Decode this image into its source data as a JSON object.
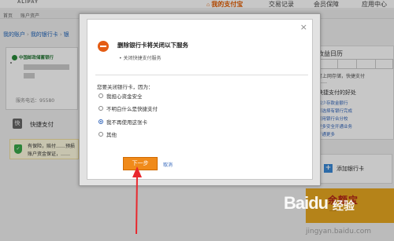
{
  "header": {
    "logo": "ALIPAY",
    "nav": [
      {
        "label": "我的支付宝",
        "active": true
      },
      {
        "label": "交易记录",
        "active": false
      },
      {
        "label": "会员保障",
        "active": false
      },
      {
        "label": "应用中心",
        "active": false
      }
    ]
  },
  "subnav": [
    "首页",
    "账户资产"
  ],
  "breadcrumb": [
    "我的账户",
    "我的银行卡",
    "银"
  ],
  "card": {
    "bank_name": "中国邮政储蓄银行",
    "phone": "服务电话：95580"
  },
  "quickpay": {
    "icon": "快",
    "label": "快捷支付"
  },
  "promo": {
    "line1": "有保险，赔付……预损",
    "line2": "账户资金保证，……"
  },
  "right_panel": {
    "title": "收益日历",
    "lines": [
      "可上网存储，快捷支付",
      "……"
    ],
    "section": "快捷支付的好处",
    "links": [
      "最少存款金额行",
      "可选择有银行完成",
      "可用银行合分校",
      "更多安全开通业务",
      "开通更多"
    ]
  },
  "add_card": {
    "label": "添加银行卡"
  },
  "yeb": {
    "label": "余额宝",
    "sub": "……"
  },
  "watermark": {
    "brand": "Baidu",
    "tag": "经验",
    "url": "jingyan.baidu.com"
  },
  "modal": {
    "close": "×",
    "title": "删除银行卡将关闭以下服务",
    "bullet": "• 关闭快捷支付服务",
    "reason_label": "您要关闭银行卡，因为：",
    "options": [
      {
        "label": "我担心资金安全",
        "checked": false
      },
      {
        "label": "不明白什么是快捷支付",
        "checked": false
      },
      {
        "label": "我不再使用这张卡",
        "checked": true
      },
      {
        "label": "其他",
        "checked": false
      }
    ],
    "next_button": "下一步",
    "cancel_link": "取消"
  },
  "colors": {
    "accent": "#e25c00",
    "button": "#f08a1a",
    "link": "#3366bb"
  }
}
